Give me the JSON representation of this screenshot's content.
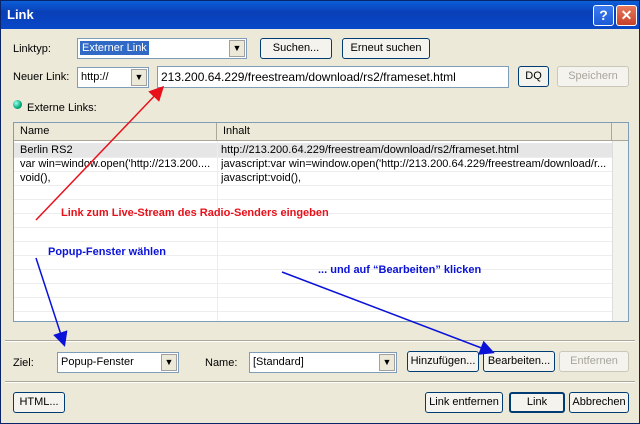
{
  "window": {
    "title": "Link",
    "help": "?",
    "close": "✕"
  },
  "linktyp": {
    "label": "Linktyp:",
    "value": "Externer Link"
  },
  "buttons": {
    "suchen": "Suchen...",
    "erneut": "Erneut suchen",
    "dq": "DQ",
    "speichern": "Speichern",
    "hinzufuegen": "Hinzufügen...",
    "bearbeiten": "Bearbeiten...",
    "entfernen": "Entfernen",
    "html": "HTML...",
    "link_entfernen": "Link entfernen",
    "link": "Link",
    "abbrechen": "Abbrechen"
  },
  "neuer_link": {
    "label": "Neuer Link:",
    "protocol": "http://",
    "url": "213.200.64.229/freestream/download/rs2/frameset.html"
  },
  "externe_links": {
    "label": "Externe Links:",
    "columns": [
      "Name",
      "Inhalt"
    ],
    "rows": [
      {
        "name": "Berlin RS2",
        "inhalt": "http://213.200.64.229/freestream/download/rs2/frameset.html"
      },
      {
        "name": "var win=window.open('http://213.200....",
        "inhalt": "javascript:var win=window.open('http://213.200.64.229/freestream/download/r..."
      },
      {
        "name": "void(),",
        "inhalt": "javascript:void(),"
      }
    ]
  },
  "ziel": {
    "label": "Ziel:",
    "value": "Popup-Fenster"
  },
  "name": {
    "label": "Name:",
    "value": "[Standard]"
  },
  "annotations": {
    "a1": "Link zum Live-Stream des Radio-Senders eingeben",
    "a2": "Popup-Fenster wählen",
    "a3": "... und auf “Bearbeiten” klicken"
  },
  "colors": {
    "red": "#e8101a",
    "blue": "#0a12d8"
  }
}
